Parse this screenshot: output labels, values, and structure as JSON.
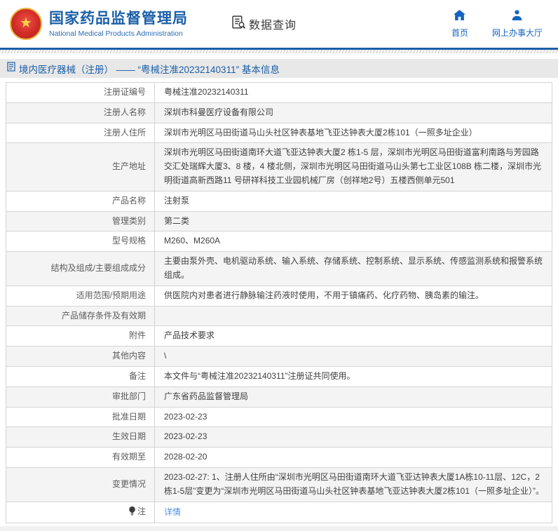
{
  "header": {
    "org_name_zh": "国家药品监督管理局",
    "org_name_en": "National Medical Products Administration",
    "section_label": "数据查询",
    "nav": {
      "home": "首页",
      "service_hall": "网上办事大厅"
    }
  },
  "title_bar": {
    "text": "境内医疗器械（注册） —— “粤械注准20232140311” 基本信息"
  },
  "table": {
    "rows": [
      {
        "label": "注册证编号",
        "value": "粤械注准20232140311"
      },
      {
        "label": "注册人名称",
        "value": "深圳市科曼医疗设备有限公司"
      },
      {
        "label": "注册人住所",
        "value": "深圳市光明区马田街道马山头社区钟表基地飞亚达钟表大厦2栋101（一照多址企业）"
      },
      {
        "label": "生产地址",
        "value": "深圳市光明区马田街道南环大道飞亚达钟表大厦2 栋1-5 层，深圳市光明区马田街道富利南路与芳园路交汇处瑞辉大厦3、8 楼，4 楼北侧，深圳市光明区马田街道马山头第七工业区108B 栋二楼，深圳市光明街道高新西路11 号研祥科技工业园机械厂房（创祥地2号）五楼西侧单元501"
      },
      {
        "label": "产品名称",
        "value": "注射泵"
      },
      {
        "label": "管理类别",
        "value": "第二类"
      },
      {
        "label": "型号规格",
        "value": "M260、M260A"
      },
      {
        "label": "结构及组成/主要组成成分",
        "value": "主要由泵外壳、电机驱动系统、输入系统、存储系统、控制系统、显示系统、传感监测系统和报警系统组成。"
      },
      {
        "label": "适用范围/预期用途",
        "value": "供医院内对患者进行静脉输注药液时使用，不用于镇痛药、化疗药物、胰岛素的输注。"
      },
      {
        "label": "产品储存条件及有效期",
        "value": ""
      },
      {
        "label": "附件",
        "value": "产品技术要求"
      },
      {
        "label": "其他内容",
        "value": "\\"
      },
      {
        "label": "备注",
        "value": "本文件与“粤械注准20232140311”注册证共同使用。"
      },
      {
        "label": "审批部门",
        "value": "广东省药品监督管理局"
      },
      {
        "label": "批准日期",
        "value": "2023-02-23"
      },
      {
        "label": "生效日期",
        "value": "2023-02-23"
      },
      {
        "label": "有效期至",
        "value": "2028-02-20"
      },
      {
        "label": "变更情况",
        "value": "2023-02-27: 1、注册人住所由“深圳市光明区马田街道南环大道飞亚达钟表大厦1A栋10-11层、12C，2栋1-5层”变更为“深圳市光明区马田街道马山头社区钟表基地飞亚达钟表大厦2栋101（一照多址企业）”。"
      },
      {
        "label": "注",
        "value": "详情",
        "link": true,
        "icon": "note"
      }
    ]
  },
  "colors": {
    "brand_blue": "#1b5fa8",
    "nav_blue": "#1565c0",
    "link_blue": "#4f8fe0",
    "title_bar_bg": "#e8e8e8",
    "row_alt_bg": "#f4f4f4",
    "border": "#d4d4d4"
  }
}
